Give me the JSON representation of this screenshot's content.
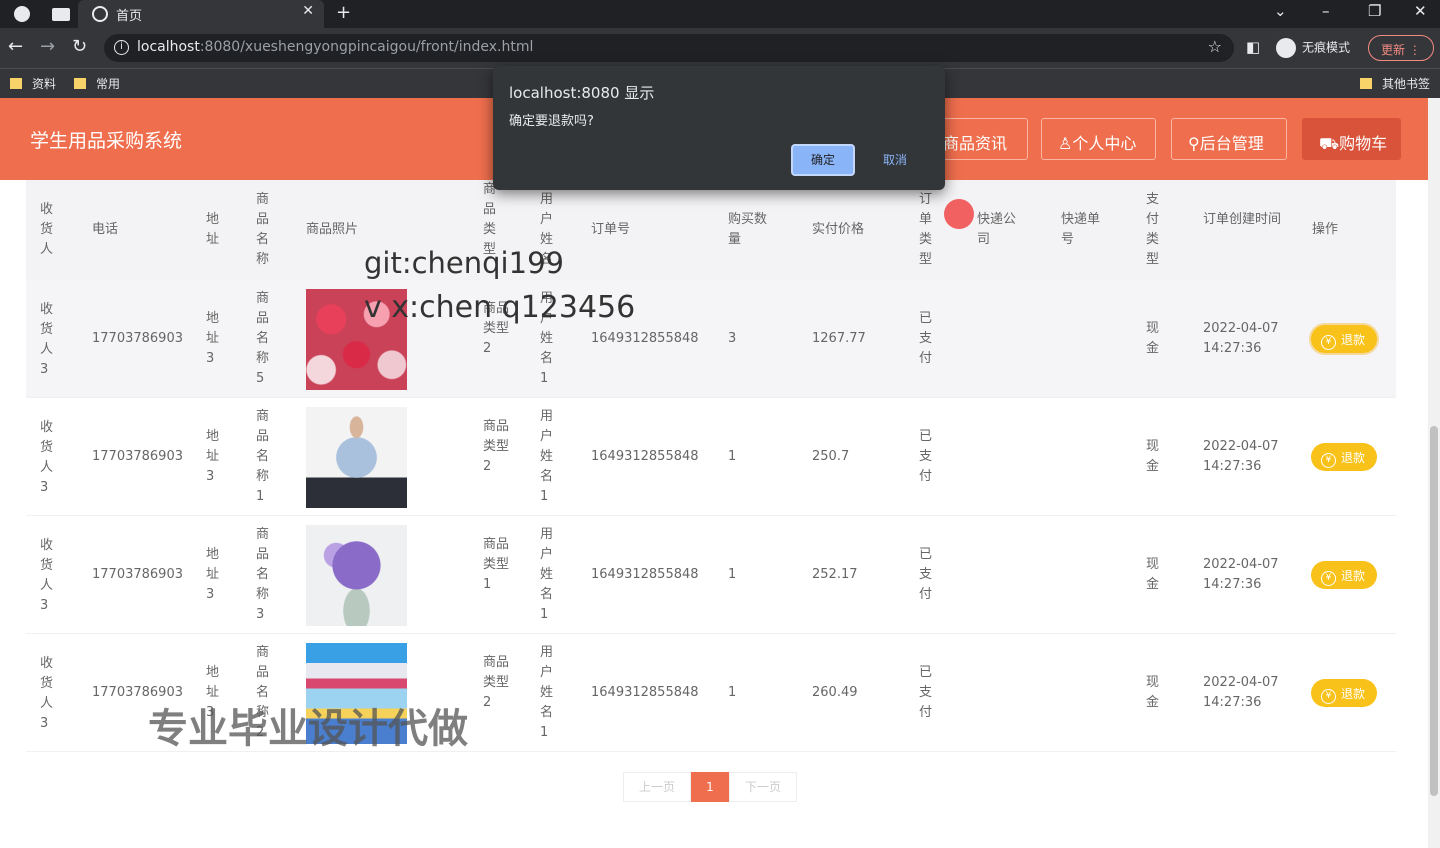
{
  "browser": {
    "tab_title": "首页",
    "url_host": "localhost",
    "url_rest": ":8080/xueshengyongpincaigou/front/index.html",
    "incognito_label": "无痕模式",
    "update_label": "更新",
    "bookmarks": [
      "资料",
      "常用"
    ],
    "other_bookmarks": "其他书签"
  },
  "site": {
    "title": "学生用品采购系统",
    "nav": [
      "商品资讯",
      "个人中心",
      "后台管理",
      "购物车"
    ]
  },
  "dialog": {
    "title": "localhost:8080 显示",
    "message": "确定要退款吗?",
    "ok": "确定",
    "cancel": "取消"
  },
  "table": {
    "headers": [
      "收货人",
      "电话",
      "地址",
      "商品名称",
      "商品照片",
      "商品类型",
      "用户姓名",
      "订单号",
      "购买数量",
      "实付价格",
      "订单类型",
      "快递公司",
      "快递单号",
      "支付类型",
      "订单创建时间",
      "操作"
    ],
    "rows": [
      {
        "receiver": "收货人3",
        "phone": "17703786903",
        "address": "地址3",
        "product": "商品名称5",
        "photo": "flowers-photo",
        "type": "商品类型2",
        "user": "用户姓名1",
        "order_no": "1649312855848",
        "qty": "3",
        "price": "1267.77",
        "order_type": "已支付",
        "courier": "",
        "tracking": "",
        "pay_type": "现金",
        "created_date": "2022-04-07",
        "created_time": "14:27:36",
        "action": "退款"
      },
      {
        "receiver": "收货人3",
        "phone": "17703786903",
        "address": "地址3",
        "product": "商品名称1",
        "photo": "shirt-photo",
        "type": "商品类型2",
        "user": "用户姓名1",
        "order_no": "1649312855848",
        "qty": "1",
        "price": "250.7",
        "order_type": "已支付",
        "courier": "",
        "tracking": "",
        "pay_type": "现金",
        "created_date": "2022-04-07",
        "created_time": "14:27:36",
        "action": "退款"
      },
      {
        "receiver": "收货人3",
        "phone": "17703786903",
        "address": "地址3",
        "product": "商品名称3",
        "photo": "bouquet-photo",
        "type": "商品类型1",
        "user": "用户姓名1",
        "order_no": "1649312855848",
        "qty": "1",
        "price": "252.17",
        "order_type": "已支付",
        "courier": "",
        "tracking": "",
        "pay_type": "现金",
        "created_date": "2022-04-07",
        "created_time": "14:27:36",
        "action": "退款"
      },
      {
        "receiver": "收货人3",
        "phone": "17703786903",
        "address": "地址3",
        "product": "商品名称2",
        "photo": "shelf-photo",
        "type": "商品类型2",
        "user": "用户姓名1",
        "order_no": "1649312855848",
        "qty": "1",
        "price": "260.49",
        "order_type": "已支付",
        "courier": "",
        "tracking": "",
        "pay_type": "现金",
        "created_date": "2022-04-07",
        "created_time": "14:27:36",
        "action": "退款"
      }
    ]
  },
  "pager": {
    "prev": "上一页",
    "current": "1",
    "next": "下一页"
  },
  "watermarks": {
    "git": "git:chenqi199",
    "vx": "v x:chen q123456",
    "ad": "专业毕业设计代做"
  }
}
